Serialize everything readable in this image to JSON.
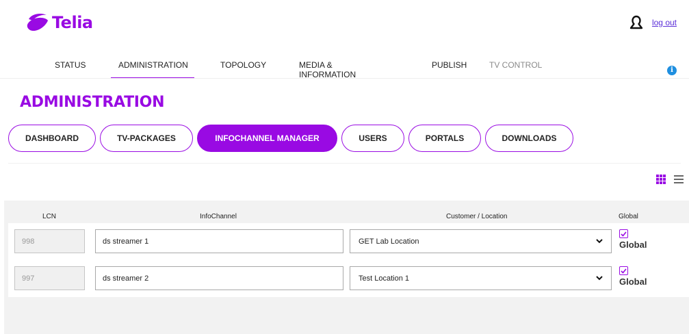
{
  "brand": {
    "name": "Telia",
    "color": "#990ae3"
  },
  "header": {
    "logout_label": "log out",
    "user_icon": "user-icon"
  },
  "nav": {
    "items": [
      {
        "label": "STATUS"
      },
      {
        "label": "ADMINISTRATION"
      },
      {
        "label": "TOPOLOGY"
      },
      {
        "label": "MEDIA & INFORMATION"
      },
      {
        "label": "PUBLISH"
      },
      {
        "label": "TV CONTROL"
      }
    ],
    "info_icon": "i"
  },
  "page": {
    "title": "ADMINISTRATION"
  },
  "subtabs": [
    {
      "label": "DASHBOARD"
    },
    {
      "label": "TV-PACKAGES"
    },
    {
      "label": "INFOCHANNEL MANAGER"
    },
    {
      "label": "USERS"
    },
    {
      "label": "PORTALS"
    },
    {
      "label": "DOWNLOADS"
    }
  ],
  "table": {
    "headers": {
      "lcn": "LCN",
      "infochannel": "InfoChannel",
      "location": "Customer / Location",
      "global": "Global"
    },
    "rows": [
      {
        "lcn": "998",
        "infochannel": "ds streamer 1",
        "location": "GET Lab Location",
        "global_checked": true,
        "global_label": "Global"
      },
      {
        "lcn": "997",
        "infochannel": "ds streamer 2",
        "location": "Test Location 1",
        "global_checked": true,
        "global_label": "Global"
      }
    ]
  }
}
